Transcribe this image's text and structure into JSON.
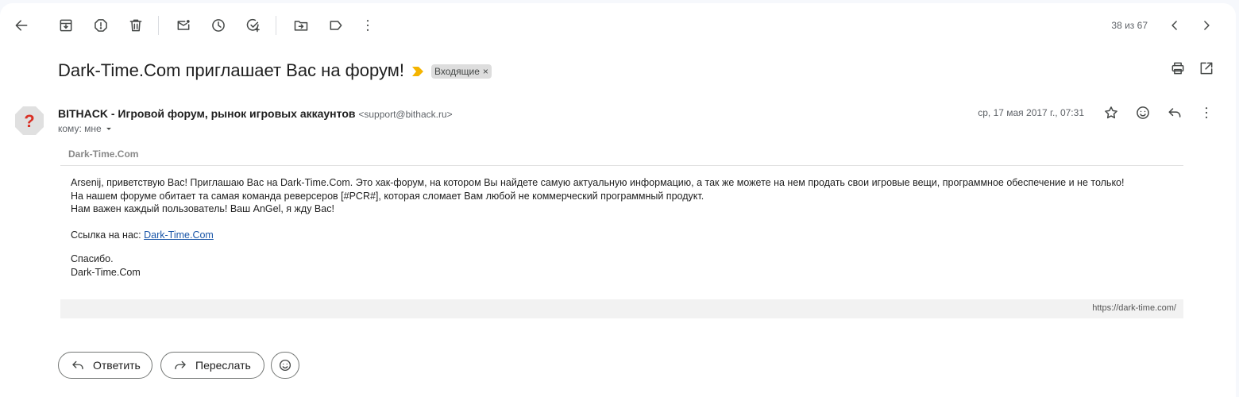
{
  "toolbar": {
    "icons": [
      "back-arrow-icon",
      "archive-icon",
      "report-spam-icon",
      "delete-icon",
      "mark-unread-icon",
      "snooze-icon",
      "add-task-icon",
      "move-to-icon",
      "label-icon",
      "more-vert-icon"
    ],
    "counter": "38 из 67"
  },
  "email": {
    "subject": "Dark-Time.Com приглашает Вас на форум!",
    "label": "Входящие",
    "label_remove": "×",
    "sender_name": "BITHACK - Игровой форум, рынок игровых аккаунтов",
    "sender_email": "<support@bithack.ru>",
    "recipient": "кому: мне",
    "date": "ср, 17 мая 2017 г., 07:31"
  },
  "message": {
    "header": "Dark-Time.Com",
    "lines": [
      "Arsenij, приветствую Вас! Приглашаю Вас на Dark-Time.Com. Это хак-форум, на котором Вы найдете самую актуальную информацию, а так же можете на нем продать свои игровые вещи, программное обеспечение и не только!",
      "На нашем форуме обитает та самая команда реверсеров [#PCR#], которая сломает Вам любой не коммерческий программный продукт.",
      "Нам важен каждый пользователь! Ваш AnGel, я жду Вас!"
    ],
    "link_prefix": "Ссылка на нас: ",
    "link_text": "Dark-Time.Com",
    "thanks": "Спасибо.",
    "signature": "Dark-Time.Com",
    "footer_url": "https://dark-time.com/"
  },
  "actions": {
    "reply": "Ответить",
    "forward": "Переслать"
  },
  "colors": {
    "important_marker": "#f4b400",
    "avatar_bg": "#e0e0e0",
    "avatar_mark": "#d93025",
    "link": "#1a56a8"
  }
}
